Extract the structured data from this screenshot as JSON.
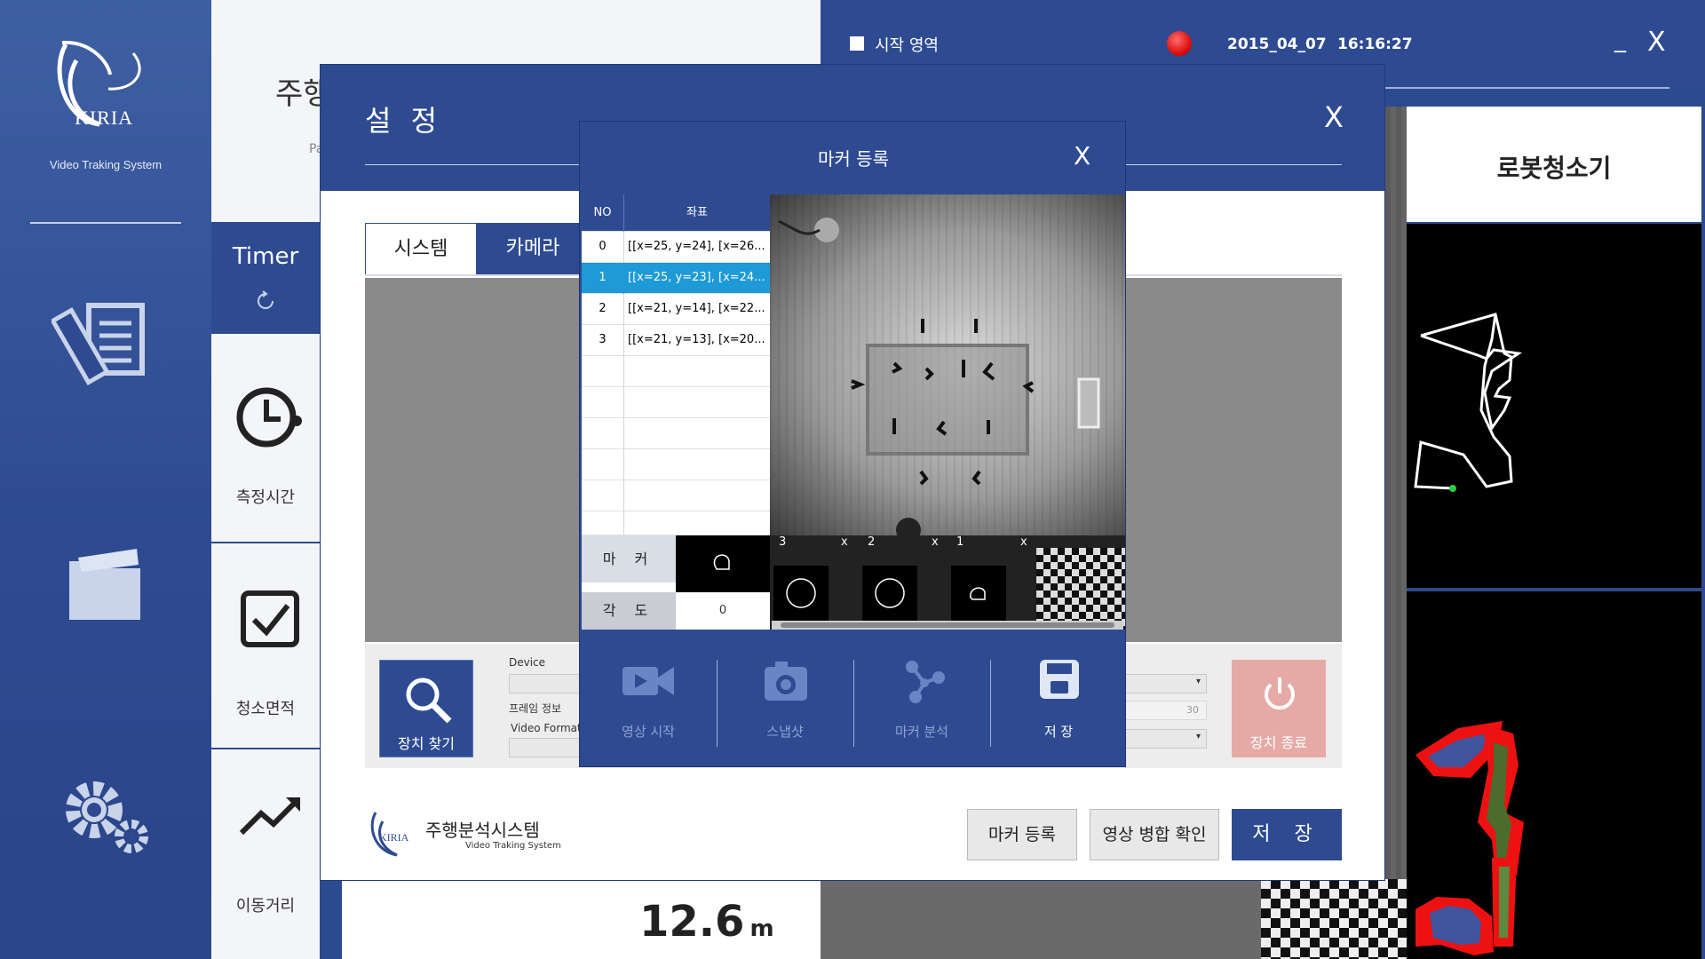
{
  "sidebar": {
    "logo": "KIRIA",
    "subtitle": "Video Traking System",
    "icons": [
      "report-icon",
      "folder-icon",
      "settings-icon"
    ]
  },
  "menu": {
    "timer_label": "Timer",
    "items": [
      {
        "label": "측정시간",
        "icon": "clock-icon"
      },
      {
        "label": "청소면적",
        "icon": "checkbox-icon"
      },
      {
        "label": "이동거리",
        "icon": "trend-icon"
      }
    ]
  },
  "background": {
    "title_partial": "주행",
    "sub_partial": "Pa",
    "distance_value": "12.6",
    "distance_unit": "m"
  },
  "top_bar": {
    "start_region_label": "시작 영역",
    "date": "2015_04_07",
    "time": "16:16:27",
    "minimize": "_",
    "close": "X"
  },
  "right_panel": {
    "title": "로봇청소기"
  },
  "settings": {
    "title": "설 정",
    "close": "X",
    "tabs": [
      "시스템",
      "카메라"
    ],
    "find_device": "장치 찾기",
    "device_label": "Device",
    "frame_info_label": "프레임 정보",
    "video_format_label": "Video Format",
    "fps_value": "30",
    "end_device": "장치 종료",
    "footer_title": "주행분석시스템",
    "footer_sub": "Video Traking System",
    "marker_register_button": "마커 등록",
    "merge_check_button": "영상 병합 확인",
    "save_button": "저 장"
  },
  "marker_dialog": {
    "title": "마커 등록",
    "close": "X",
    "table": {
      "headers": [
        "NO",
        "좌표"
      ],
      "rows": [
        {
          "no": "0",
          "coord": "[[x=25, y=24], [x=26..."
        },
        {
          "no": "1",
          "coord": "[[x=25, y=23], [x=24..."
        },
        {
          "no": "2",
          "coord": "[[x=21, y=14], [x=22..."
        },
        {
          "no": "3",
          "coord": "[[x=21, y=13], [x=20..."
        }
      ],
      "selected_index": 1
    },
    "marker_label": "마 커",
    "angle_label": "각 도",
    "angle_value": "0",
    "thumbnails": [
      {
        "id": "3",
        "close": "x"
      },
      {
        "id": "2",
        "close": "x"
      },
      {
        "id": "1",
        "close": "x"
      }
    ],
    "actions": [
      {
        "label": "영상 시작",
        "icon": "video-camera-icon",
        "enabled": false
      },
      {
        "label": "스냅샷",
        "icon": "camera-icon",
        "enabled": false
      },
      {
        "label": "마커 분석",
        "icon": "network-icon",
        "enabled": false
      },
      {
        "label": "저 장",
        "icon": "floppy-disk-icon",
        "enabled": true
      }
    ]
  },
  "colors": {
    "primary": "#2e4b92",
    "selected_row": "#1e9ad6",
    "end_button": "#e6aaa6",
    "record": "#dd1111"
  }
}
